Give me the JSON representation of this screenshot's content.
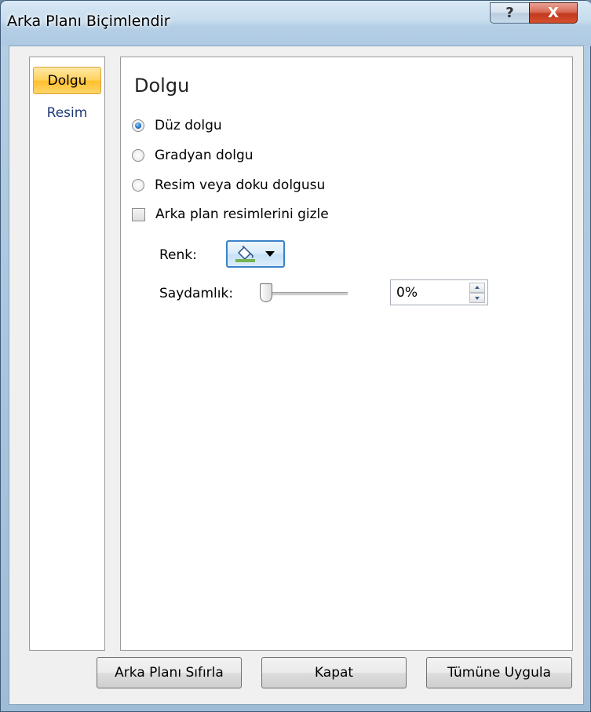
{
  "window": {
    "title": "Arka Planı Biçimlendir",
    "help_glyph": "?",
    "close_glyph": "X"
  },
  "nav": {
    "items": [
      {
        "label": "Dolgu",
        "selected": true
      },
      {
        "label": "Resim",
        "selected": false
      }
    ]
  },
  "panel": {
    "title": "Dolgu",
    "fill_options": [
      {
        "label": "Düz dolgu",
        "checked": true
      },
      {
        "label": "Gradyan dolgu",
        "checked": false
      },
      {
        "label": "Resim veya doku dolgusu",
        "checked": false
      }
    ],
    "hide_bg_label": "Arka plan resimlerini gizle",
    "hide_bg_checked": false,
    "color_label": "Renk:",
    "color_value": "#77b255",
    "color_icon": "paint-bucket-icon",
    "transparency_label": "Saydamlık:",
    "transparency_value": "0%",
    "transparency_level": 0
  },
  "buttons": {
    "reset": "Arka Planı Sıfırla",
    "close": "Kapat",
    "apply_all": "Tümüne Uygula"
  }
}
